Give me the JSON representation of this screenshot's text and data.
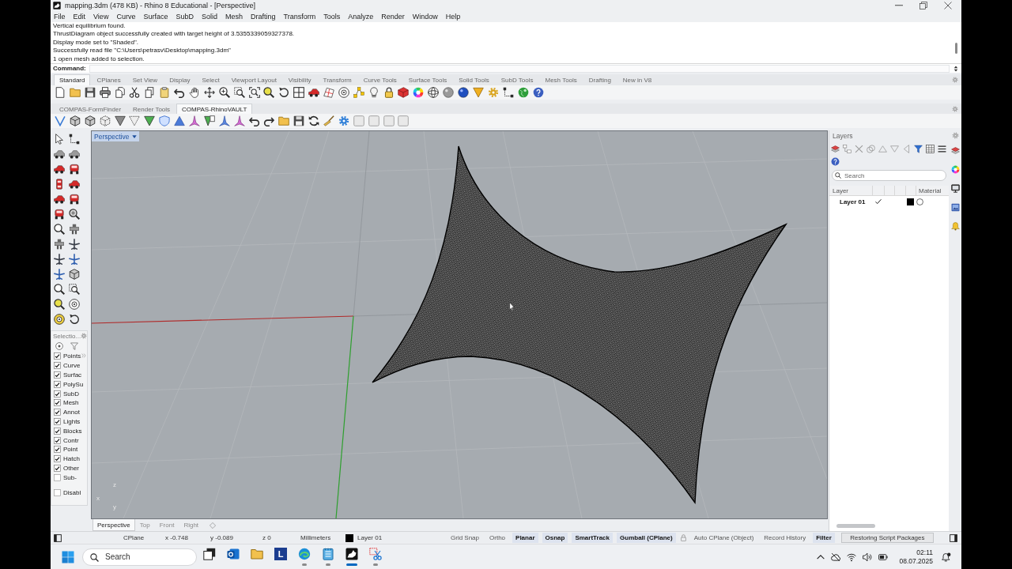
{
  "window": {
    "title": "mapping.3dm (478 KB) - Rhino 8 Educational - [Perspective]"
  },
  "menu": [
    "File",
    "Edit",
    "View",
    "Curve",
    "Surface",
    "SubD",
    "Solid",
    "Mesh",
    "Drafting",
    "Transform",
    "Tools",
    "Analyze",
    "Render",
    "Window",
    "Help"
  ],
  "command_history": [
    "Vertical equilibrium found.",
    "ThrustDiagram object successfully created with target height of 3.5355339059327378.",
    "Display mode set to \"Shaded\".",
    "Successfully read file \"C:\\Users\\petrasv\\Desktop\\mapping.3dm\"",
    "1 open mesh added to selection."
  ],
  "command_line": {
    "prompt": "Command:"
  },
  "toolbar_tabs": [
    {
      "label": "Standard",
      "selected": true
    },
    {
      "label": "CPlanes",
      "selected": false
    },
    {
      "label": "Set View",
      "selected": false
    },
    {
      "label": "Display",
      "selected": false
    },
    {
      "label": "Select",
      "selected": false
    },
    {
      "label": "Viewport Layout",
      "selected": false
    },
    {
      "label": "Visibility",
      "selected": false
    },
    {
      "label": "Transform",
      "selected": false
    },
    {
      "label": "Curve Tools",
      "selected": false
    },
    {
      "label": "Surface Tools",
      "selected": false
    },
    {
      "label": "Solid Tools",
      "selected": false
    },
    {
      "label": "SubD Tools",
      "selected": false
    },
    {
      "label": "Mesh Tools",
      "selected": false
    },
    {
      "label": "Drafting",
      "selected": false
    },
    {
      "label": "New in V8",
      "selected": false
    }
  ],
  "toolbar_tabs_2": [
    {
      "label": "COMPAS-FormFinder",
      "selected": false
    },
    {
      "label": "Render Tools",
      "selected": false
    },
    {
      "label": "COMPAS-RhinoVAULT",
      "selected": true
    }
  ],
  "selection_panel": {
    "title": "Selectio...",
    "filters": [
      {
        "label": "Points",
        "checked": true
      },
      {
        "label": "Curve",
        "checked": true
      },
      {
        "label": "Surfac",
        "checked": true
      },
      {
        "label": "PolySu",
        "checked": true
      },
      {
        "label": "SubD",
        "checked": true
      },
      {
        "label": "Mesh",
        "checked": true
      },
      {
        "label": "Annot",
        "checked": true
      },
      {
        "label": "Lights",
        "checked": true
      },
      {
        "label": "Blocks",
        "checked": true
      },
      {
        "label": "Contr",
        "checked": true
      },
      {
        "label": "Point",
        "checked": true
      },
      {
        "label": "Hatch",
        "checked": true
      },
      {
        "label": "Other",
        "checked": true
      },
      {
        "label": "Sub-",
        "checked": false
      }
    ],
    "disable": {
      "label": "Disabl",
      "checked": false
    }
  },
  "viewport": {
    "label": "Perspective",
    "axis_labels": {
      "z": "z",
      "x": "x",
      "y": "y"
    }
  },
  "viewport_tabs": [
    {
      "label": "Perspective",
      "selected": true
    },
    {
      "label": "Top",
      "selected": false
    },
    {
      "label": "Front",
      "selected": false
    },
    {
      "label": "Right",
      "selected": false
    }
  ],
  "layers_panel": {
    "title": "Layers",
    "search": {
      "placeholder": "Search"
    },
    "columns": [
      "Layer",
      "Material"
    ],
    "rows": [
      {
        "name": "Layer 01",
        "current": true,
        "color": "#000000"
      }
    ]
  },
  "status_bar": {
    "cplane": "CPlane",
    "x": "x -0.748",
    "y": "y -0.089",
    "z": "z 0",
    "units": "Millimeters",
    "layer": {
      "name": "Layer 01",
      "color": "#000000"
    },
    "toggles": [
      {
        "label": "Grid Snap",
        "on": false,
        "locked": false
      },
      {
        "label": "Ortho",
        "on": false,
        "locked": false
      },
      {
        "label": "Planar",
        "on": true,
        "locked": false
      },
      {
        "label": "Osnap",
        "on": true,
        "locked": false
      },
      {
        "label": "SmartTrack",
        "on": true,
        "locked": false
      },
      {
        "label": "Gumball (CPlane)",
        "on": true,
        "locked": false
      },
      {
        "label": "Auto CPlane (Object)",
        "on": false,
        "locked": true
      },
      {
        "label": "Record History",
        "on": false,
        "locked": false
      },
      {
        "label": "Filter",
        "on": true,
        "locked": false
      }
    ],
    "message": "Restoring Script Packages"
  },
  "taskbar": {
    "search": {
      "placeholder": "Search"
    },
    "apps": [
      {
        "kind": "taskview",
        "running": false,
        "selected": false
      },
      {
        "kind": "mail",
        "running": false,
        "selected": false
      },
      {
        "kind": "folder",
        "running": false,
        "selected": false
      },
      {
        "kind": "letter",
        "label": "L",
        "running": false,
        "selected": false
      },
      {
        "kind": "browser",
        "running": true,
        "selected": false
      },
      {
        "kind": "notepad",
        "running": true,
        "selected": false
      },
      {
        "kind": "rhino",
        "running": true,
        "selected": true
      },
      {
        "kind": "snipping",
        "running": true,
        "selected": false
      }
    ],
    "time": "02:11",
    "date": "08.07.2025"
  }
}
